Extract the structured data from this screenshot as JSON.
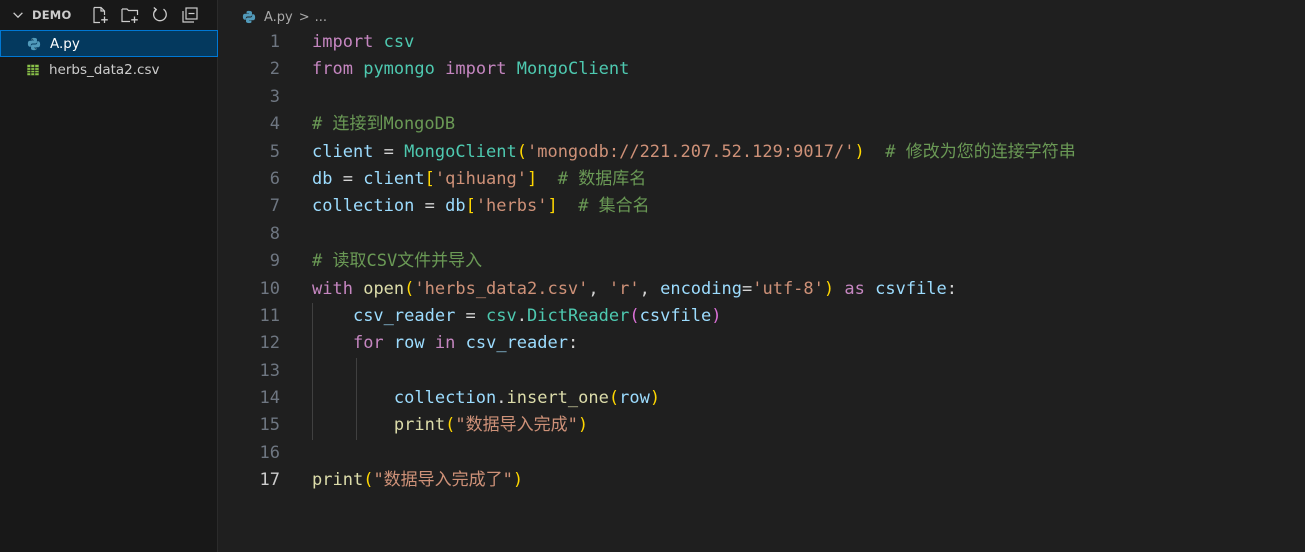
{
  "explorer": {
    "folder_name": "DEMO",
    "actions": [
      {
        "name": "new-file",
        "title": "New File"
      },
      {
        "name": "new-folder",
        "title": "New Folder"
      },
      {
        "name": "refresh",
        "title": "Refresh Explorer"
      },
      {
        "name": "collapse",
        "title": "Collapse Folders"
      }
    ],
    "files": [
      {
        "name": "A.py",
        "type": "python",
        "active": true
      },
      {
        "name": "herbs_data2.csv",
        "type": "csv",
        "active": false
      }
    ]
  },
  "editor": {
    "breadcrumb": {
      "file": "A.py",
      "separator": ">",
      "rest": "..."
    },
    "current_line": 17,
    "lines": [
      {
        "n": "1",
        "tokens": [
          [
            "kw",
            "import"
          ],
          [
            "op",
            " "
          ],
          [
            "mod",
            "csv"
          ]
        ]
      },
      {
        "n": "2",
        "tokens": [
          [
            "kw",
            "from"
          ],
          [
            "op",
            " "
          ],
          [
            "mod",
            "pymongo"
          ],
          [
            "op",
            " "
          ],
          [
            "kw",
            "import"
          ],
          [
            "op",
            " "
          ],
          [
            "cls",
            "MongoClient"
          ]
        ]
      },
      {
        "n": "3",
        "tokens": []
      },
      {
        "n": "4",
        "tokens": [
          [
            "com",
            "# 连接到MongoDB"
          ]
        ]
      },
      {
        "n": "5",
        "tokens": [
          [
            "var",
            "client"
          ],
          [
            "op",
            " = "
          ],
          [
            "cls",
            "MongoClient"
          ],
          [
            "p1",
            "("
          ],
          [
            "str",
            "'mongodb://221.207.52.129:9017/'"
          ],
          [
            "p1",
            ")"
          ],
          [
            "op",
            "  "
          ],
          [
            "com",
            "# 修改为您的连接字符串"
          ]
        ]
      },
      {
        "n": "6",
        "tokens": [
          [
            "var",
            "db"
          ],
          [
            "op",
            " = "
          ],
          [
            "var",
            "client"
          ],
          [
            "p1",
            "["
          ],
          [
            "str",
            "'qihuang'"
          ],
          [
            "p1",
            "]"
          ],
          [
            "op",
            "  "
          ],
          [
            "com",
            "# 数据库名"
          ]
        ]
      },
      {
        "n": "7",
        "tokens": [
          [
            "var",
            "collection"
          ],
          [
            "op",
            " = "
          ],
          [
            "var",
            "db"
          ],
          [
            "p1",
            "["
          ],
          [
            "str",
            "'herbs'"
          ],
          [
            "p1",
            "]"
          ],
          [
            "op",
            "  "
          ],
          [
            "com",
            "# 集合名"
          ]
        ]
      },
      {
        "n": "8",
        "tokens": []
      },
      {
        "n": "9",
        "tokens": [
          [
            "com",
            "# 读取CSV文件并导入"
          ]
        ]
      },
      {
        "n": "10",
        "tokens": [
          [
            "kw",
            "with"
          ],
          [
            "op",
            " "
          ],
          [
            "fn",
            "open"
          ],
          [
            "p1",
            "("
          ],
          [
            "str",
            "'herbs_data2.csv'"
          ],
          [
            "op",
            ", "
          ],
          [
            "str",
            "'r'"
          ],
          [
            "op",
            ", "
          ],
          [
            "var",
            "encoding"
          ],
          [
            "op",
            "="
          ],
          [
            "str",
            "'utf-8'"
          ],
          [
            "p1",
            ")"
          ],
          [
            "op",
            " "
          ],
          [
            "kw",
            "as"
          ],
          [
            "op",
            " "
          ],
          [
            "var",
            "csvfile"
          ],
          [
            "op",
            ":"
          ]
        ]
      },
      {
        "n": "11",
        "tokens": [
          [
            "op",
            "    "
          ],
          [
            "var",
            "csv_reader"
          ],
          [
            "op",
            " = "
          ],
          [
            "mod",
            "csv"
          ],
          [
            "op",
            "."
          ],
          [
            "cls",
            "DictReader"
          ],
          [
            "p2",
            "("
          ],
          [
            "var",
            "csvfile"
          ],
          [
            "p2",
            ")"
          ]
        ]
      },
      {
        "n": "12",
        "tokens": [
          [
            "op",
            "    "
          ],
          [
            "kw",
            "for"
          ],
          [
            "op",
            " "
          ],
          [
            "var",
            "row"
          ],
          [
            "op",
            " "
          ],
          [
            "kw",
            "in"
          ],
          [
            "op",
            " "
          ],
          [
            "var",
            "csv_reader"
          ],
          [
            "op",
            ":"
          ]
        ]
      },
      {
        "n": "13",
        "tokens": []
      },
      {
        "n": "14",
        "tokens": [
          [
            "op",
            "        "
          ],
          [
            "var",
            "collection"
          ],
          [
            "op",
            "."
          ],
          [
            "fn",
            "insert_one"
          ],
          [
            "p1",
            "("
          ],
          [
            "var",
            "row"
          ],
          [
            "p1",
            ")"
          ]
        ]
      },
      {
        "n": "15",
        "tokens": [
          [
            "op",
            "        "
          ],
          [
            "fn",
            "print"
          ],
          [
            "p1",
            "("
          ],
          [
            "str",
            "\"数据导入完成\""
          ],
          [
            "p1",
            ")"
          ]
        ]
      },
      {
        "n": "16",
        "tokens": []
      },
      {
        "n": "17",
        "tokens": [
          [
            "fn",
            "print"
          ],
          [
            "p1",
            "("
          ],
          [
            "str",
            "\"数据导入完成了\""
          ],
          [
            "p1",
            ")"
          ]
        ]
      }
    ]
  },
  "colors": {
    "sidebar_bg": "#181818",
    "editor_bg": "#1f1f1f",
    "active_item_bg": "#04395e",
    "active_item_border": "#0078d4",
    "keyword": "#c586c0",
    "class": "#4ec9b0",
    "variable": "#9cdcfe",
    "function": "#dcdcaa",
    "string": "#ce9178",
    "comment": "#6a9955",
    "bracket_1": "#ffd700",
    "bracket_2": "#da70d6",
    "python_icon": "#519aba",
    "csv_icon": "#8bc34a"
  }
}
